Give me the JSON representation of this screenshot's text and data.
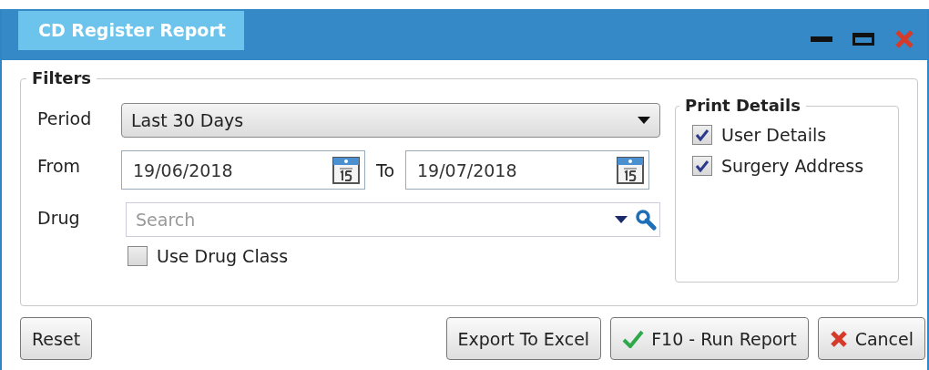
{
  "window": {
    "title": "CD Register Report"
  },
  "filters": {
    "legend": "Filters",
    "period": {
      "label": "Period",
      "value": "Last 30 Days"
    },
    "from": {
      "label": "From",
      "value": "19/06/2018"
    },
    "to": {
      "label": "To",
      "value": "19/07/2018"
    },
    "drug": {
      "label": "Drug",
      "placeholder": "Search"
    },
    "use_drug_class": {
      "label": "Use Drug Class",
      "checked": false
    }
  },
  "print_details": {
    "legend": "Print Details",
    "options": [
      {
        "label": "User Details",
        "checked": true
      },
      {
        "label": "Surgery Address",
        "checked": true
      }
    ]
  },
  "buttons": [
    {
      "label": "Reset",
      "kind": "plain"
    },
    {
      "label": "Export To Excel",
      "kind": "plain"
    },
    {
      "label": "F10 - Run Report",
      "kind": "run"
    },
    {
      "label": "Cancel",
      "kind": "cancel"
    }
  ]
}
